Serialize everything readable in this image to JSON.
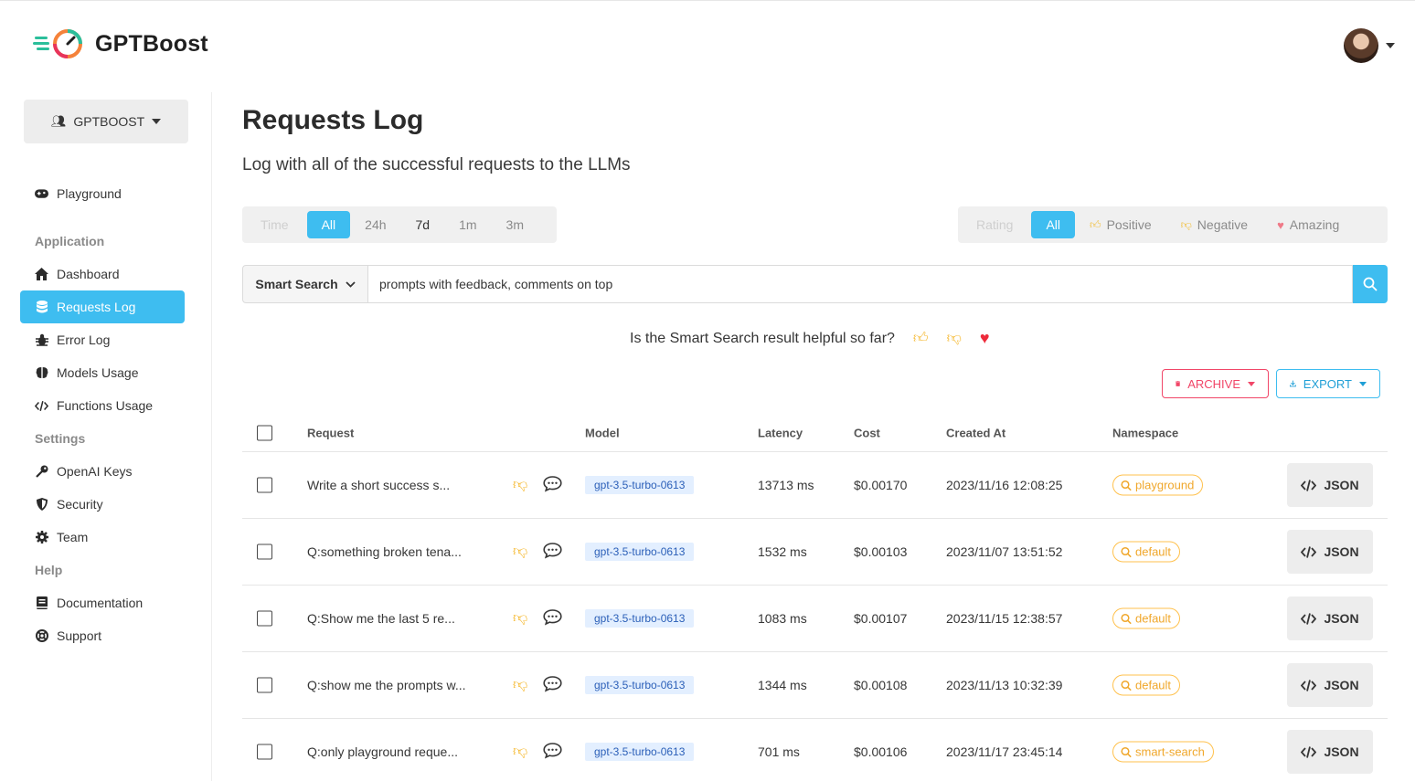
{
  "brand": {
    "name": "GPTBoost"
  },
  "sidebar": {
    "org_label": "GPTBOOST",
    "items": [
      {
        "label": "Playground",
        "icon": "gamepad-icon"
      },
      {
        "label": "Dashboard",
        "icon": "home-icon"
      },
      {
        "label": "Requests Log",
        "icon": "database-icon"
      },
      {
        "label": "Error Log",
        "icon": "bug-icon"
      },
      {
        "label": "Models Usage",
        "icon": "brain-icon"
      },
      {
        "label": "Functions Usage",
        "icon": "code-icon"
      },
      {
        "label": "OpenAI Keys",
        "icon": "key-icon"
      },
      {
        "label": "Security",
        "icon": "shield-icon"
      },
      {
        "label": "Team",
        "icon": "gear-icon"
      },
      {
        "label": "Documentation",
        "icon": "book-icon"
      },
      {
        "label": "Support",
        "icon": "lifebuoy-icon"
      }
    ],
    "sections": {
      "application": "Application",
      "settings": "Settings",
      "help": "Help"
    }
  },
  "page": {
    "title": "Requests Log",
    "subtitle": "Log with all of the successful requests to the LLMs"
  },
  "time_filter": {
    "label": "Time",
    "options": [
      "All",
      "24h",
      "7d",
      "1m",
      "3m"
    ],
    "selected": "All"
  },
  "rating_filter": {
    "label": "Rating",
    "options": [
      "All",
      "Positive",
      "Negative",
      "Amazing"
    ],
    "selected": "All"
  },
  "search": {
    "type_label": "Smart Search",
    "value": "prompts with feedback, comments on top"
  },
  "feedback": {
    "question": "Is the Smart Search result helpful so far?"
  },
  "actions": {
    "archive": "ARCHIVE",
    "export": "EXPORT"
  },
  "table": {
    "headers": {
      "request": "Request",
      "model": "Model",
      "latency": "Latency",
      "cost": "Cost",
      "created": "Created At",
      "namespace": "Namespace"
    },
    "json_label": "JSON",
    "rows": [
      {
        "request": "Write a short success s...",
        "model": "gpt-3.5-turbo-0613",
        "latency": "13713 ms",
        "cost": "$0.00170",
        "created": "2023/11/16 12:08:25",
        "namespace": "playground"
      },
      {
        "request": "Q:something broken tena...",
        "model": "gpt-3.5-turbo-0613",
        "latency": "1532 ms",
        "cost": "$0.00103",
        "created": "2023/11/07 13:51:52",
        "namespace": "default"
      },
      {
        "request": "Q:Show me the last 5 re...",
        "model": "gpt-3.5-turbo-0613",
        "latency": "1083 ms",
        "cost": "$0.00107",
        "created": "2023/11/15 12:38:57",
        "namespace": "default"
      },
      {
        "request": "Q:show me the prompts w...",
        "model": "gpt-3.5-turbo-0613",
        "latency": "1344 ms",
        "cost": "$0.00108",
        "created": "2023/11/13 10:32:39",
        "namespace": "default"
      },
      {
        "request": "Q:only playground reque...",
        "model": "gpt-3.5-turbo-0613",
        "latency": "701 ms",
        "cost": "$0.00106",
        "created": "2023/11/17 23:45:14",
        "namespace": "smart-search"
      }
    ]
  },
  "colors": {
    "accent": "#3ebdf0",
    "danger": "#f14668",
    "warning": "#ffc14d"
  }
}
